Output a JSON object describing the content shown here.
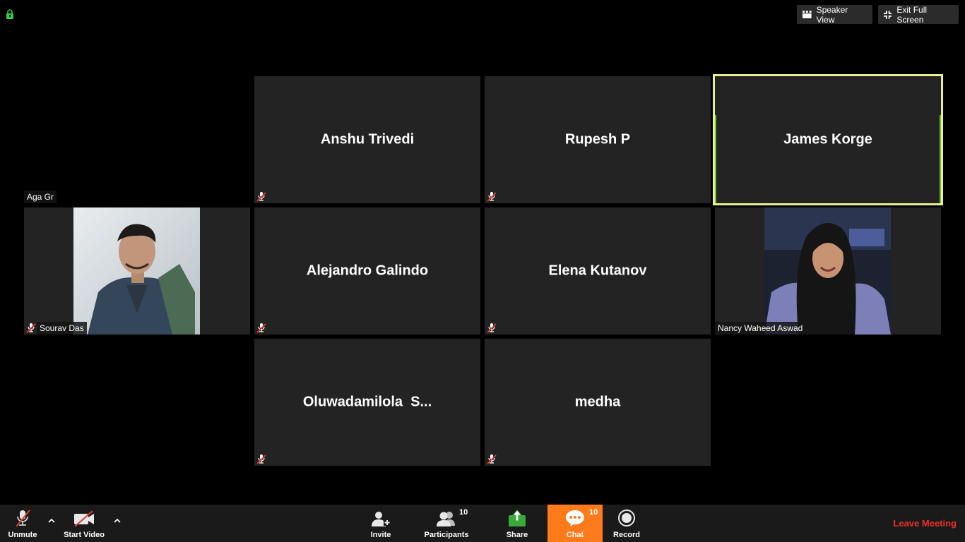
{
  "top_bar": {
    "speaker_view": "Speaker View",
    "exit_full_screen": "Exit Full Screen"
  },
  "participants": [
    {
      "name": "Aga Gr",
      "type": "label-only"
    },
    {
      "name": "Anshu Trivedi",
      "muted": true
    },
    {
      "name": "Rupesh P",
      "muted": true
    },
    {
      "name": "James Korge",
      "active_speaker": true
    },
    {
      "name": "Sourav Das",
      "muted": true,
      "video": "photo"
    },
    {
      "name": "Alejandro Galindo",
      "muted": true
    },
    {
      "name": "Elena Kutanov",
      "muted": true
    },
    {
      "name": "Nancy Waheed Aswad",
      "video": "photo"
    },
    {
      "name": "Oluwadamilola  S...",
      "muted": true
    },
    {
      "name": "medha",
      "muted": true
    }
  ],
  "toolbar": {
    "unmute": "Unmute",
    "start_video": "Start Video",
    "invite": "Invite",
    "participants": "Participants",
    "participants_count": "10",
    "share": "Share",
    "chat": "Chat",
    "chat_count": "10",
    "record": "Record",
    "leave_meeting": "Leave Meeting"
  },
  "colors": {
    "active_border": "#e7ef8e",
    "chat_bg": "#ff7a1a",
    "share_green": "#3aa83a",
    "leave_red": "#e8302b",
    "mute_red": "#e53935"
  }
}
